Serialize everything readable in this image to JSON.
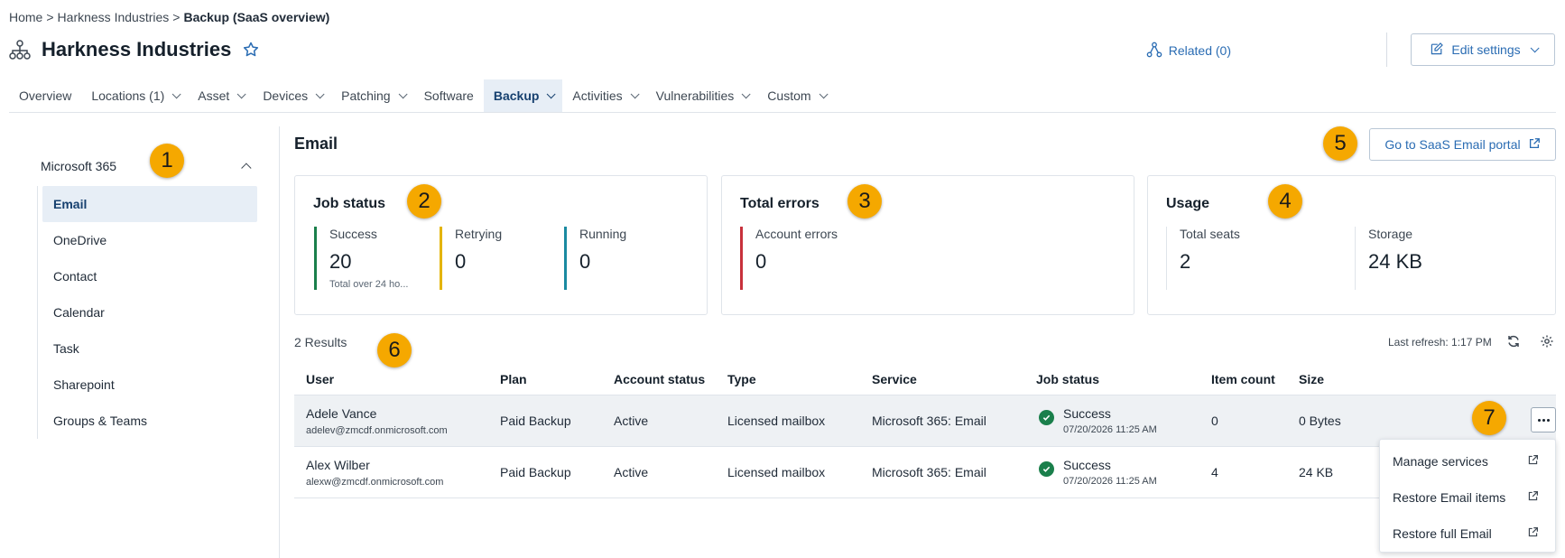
{
  "breadcrumb": {
    "items": [
      "Home",
      "Harkness Industries"
    ],
    "separator": ">",
    "current": "Backup (SaaS overview)"
  },
  "header": {
    "title": "Harkness Industries",
    "related_label": "Related (0)",
    "edit_settings_label": "Edit settings"
  },
  "tabs": [
    {
      "label": "Overview",
      "dropdown": false
    },
    {
      "label": "Locations (1)",
      "dropdown": true
    },
    {
      "label": "Asset",
      "dropdown": true
    },
    {
      "label": "Devices",
      "dropdown": true
    },
    {
      "label": "Patching",
      "dropdown": true
    },
    {
      "label": "Software",
      "dropdown": false
    },
    {
      "label": "Backup",
      "dropdown": true,
      "active": true
    },
    {
      "label": "Activities",
      "dropdown": true
    },
    {
      "label": "Vulnerabilities",
      "dropdown": true
    },
    {
      "label": "Custom",
      "dropdown": true
    }
  ],
  "sidebar": {
    "group_label": "Microsoft 365",
    "items": [
      "Email",
      "OneDrive",
      "Contact",
      "Calendar",
      "Task",
      "Sharepoint",
      "Groups & Teams"
    ],
    "active_index": 0
  },
  "main": {
    "section_title": "Email",
    "portal_button_label": "Go to SaaS Email portal",
    "job_status": {
      "title": "Job status",
      "success_label": "Success",
      "success_value": "20",
      "success_sub": "Total over 24 ho...",
      "retrying_label": "Retrying",
      "retrying_value": "0",
      "running_label": "Running",
      "running_value": "0"
    },
    "total_errors": {
      "title": "Total errors",
      "account_errors_label": "Account errors",
      "account_errors_value": "0"
    },
    "usage": {
      "title": "Usage",
      "total_seats_label": "Total seats",
      "total_seats_value": "2",
      "storage_label": "Storage",
      "storage_value": "24 KB"
    },
    "results_label": "2 Results",
    "last_refresh": "Last refresh: 1:17 PM"
  },
  "table": {
    "columns": [
      "User",
      "Plan",
      "Account status",
      "Type",
      "Service",
      "Job status",
      "Item count",
      "Size"
    ],
    "rows": [
      {
        "name": "Adele Vance",
        "email": "adelev@zmcdf.onmicrosoft.com",
        "plan": "Paid Backup",
        "account_status": "Active",
        "type": "Licensed mailbox",
        "service": "Microsoft 365: Email",
        "job_status": "Success",
        "job_time": "07/20/2026 11:25 AM",
        "item_count": "0",
        "size": "0 Bytes"
      },
      {
        "name": "Alex Wilber",
        "email": "alexw@zmcdf.onmicrosoft.com",
        "plan": "Paid Backup",
        "account_status": "Active",
        "type": "Licensed mailbox",
        "service": "Microsoft 365: Email",
        "job_status": "Success",
        "job_time": "07/20/2026 11:25 AM",
        "item_count": "4",
        "size": "24 KB"
      }
    ]
  },
  "row_menu": {
    "items": [
      "Manage services",
      "Restore Email items",
      "Restore full Email"
    ]
  },
  "callouts": [
    "1",
    "2",
    "3",
    "4",
    "5",
    "6",
    "7"
  ],
  "colors": {
    "accent": "#2a6cb3",
    "success": "#1a7f4b",
    "retrying": "#e4b400",
    "running": "#1a8aa1",
    "error": "#c8313c",
    "callout": "#f5a800"
  },
  "icons": {
    "org": "org-chart-icon",
    "favorite": "star-icon",
    "related": "hierarchy-icon",
    "edit": "pencil-icon",
    "external": "external-link-icon",
    "refresh": "refresh-icon",
    "settings": "gear-icon",
    "more": "more-horizontal-icon",
    "success": "check-circle-icon"
  }
}
